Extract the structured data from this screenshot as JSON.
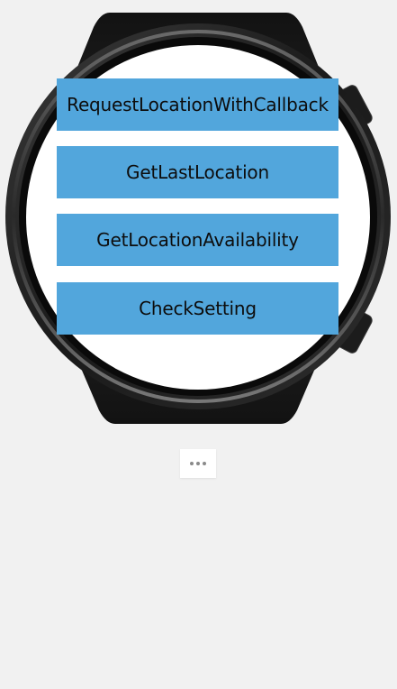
{
  "screen": {
    "buttons": [
      {
        "label": "RequestLocationWithCallback"
      },
      {
        "label": "GetLastLocation"
      },
      {
        "label": "GetLocationAvailability"
      },
      {
        "label": "CheckSetting"
      }
    ]
  },
  "more_menu": {
    "icon": "more-horizontal-icon"
  },
  "colors": {
    "background": "#f1f1f1",
    "watch_body": "#1e1e1e",
    "screen": "#ffffff",
    "button": "#52a6dc",
    "button_text": "#0d0d0d"
  }
}
